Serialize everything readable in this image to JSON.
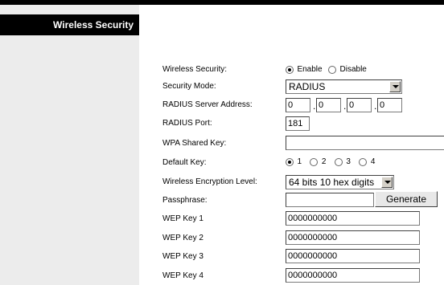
{
  "sidebar": {
    "title": "Wireless Security"
  },
  "form": {
    "wireless_security": {
      "label": "Wireless Security:",
      "enable": "Enable",
      "disable": "Disable"
    },
    "security_mode": {
      "label": "Security Mode:",
      "value": "RADIUS"
    },
    "radius_server": {
      "label": "RADIUS Server Address:",
      "octets": [
        "0",
        "0",
        "0",
        "0"
      ]
    },
    "radius_port": {
      "label": "RADIUS Port:",
      "value": "181"
    },
    "wpa_shared_key": {
      "label": "WPA Shared Key:",
      "value": ""
    },
    "default_key": {
      "label": "Default Key:",
      "options": [
        "1",
        "2",
        "3",
        "4"
      ]
    },
    "encryption_level": {
      "label": "Wireless Encryption Level:",
      "value": "64 bits 10 hex digits"
    },
    "passphrase": {
      "label": "Passphrase:",
      "value": "",
      "button": "Generate"
    },
    "wep_keys": [
      {
        "label": "WEP Key 1",
        "value": "0000000000"
      },
      {
        "label": "WEP Key 2",
        "value": "0000000000"
      },
      {
        "label": "WEP Key 3",
        "value": "0000000000"
      },
      {
        "label": "WEP Key 4",
        "value": "0000000000"
      }
    ]
  }
}
